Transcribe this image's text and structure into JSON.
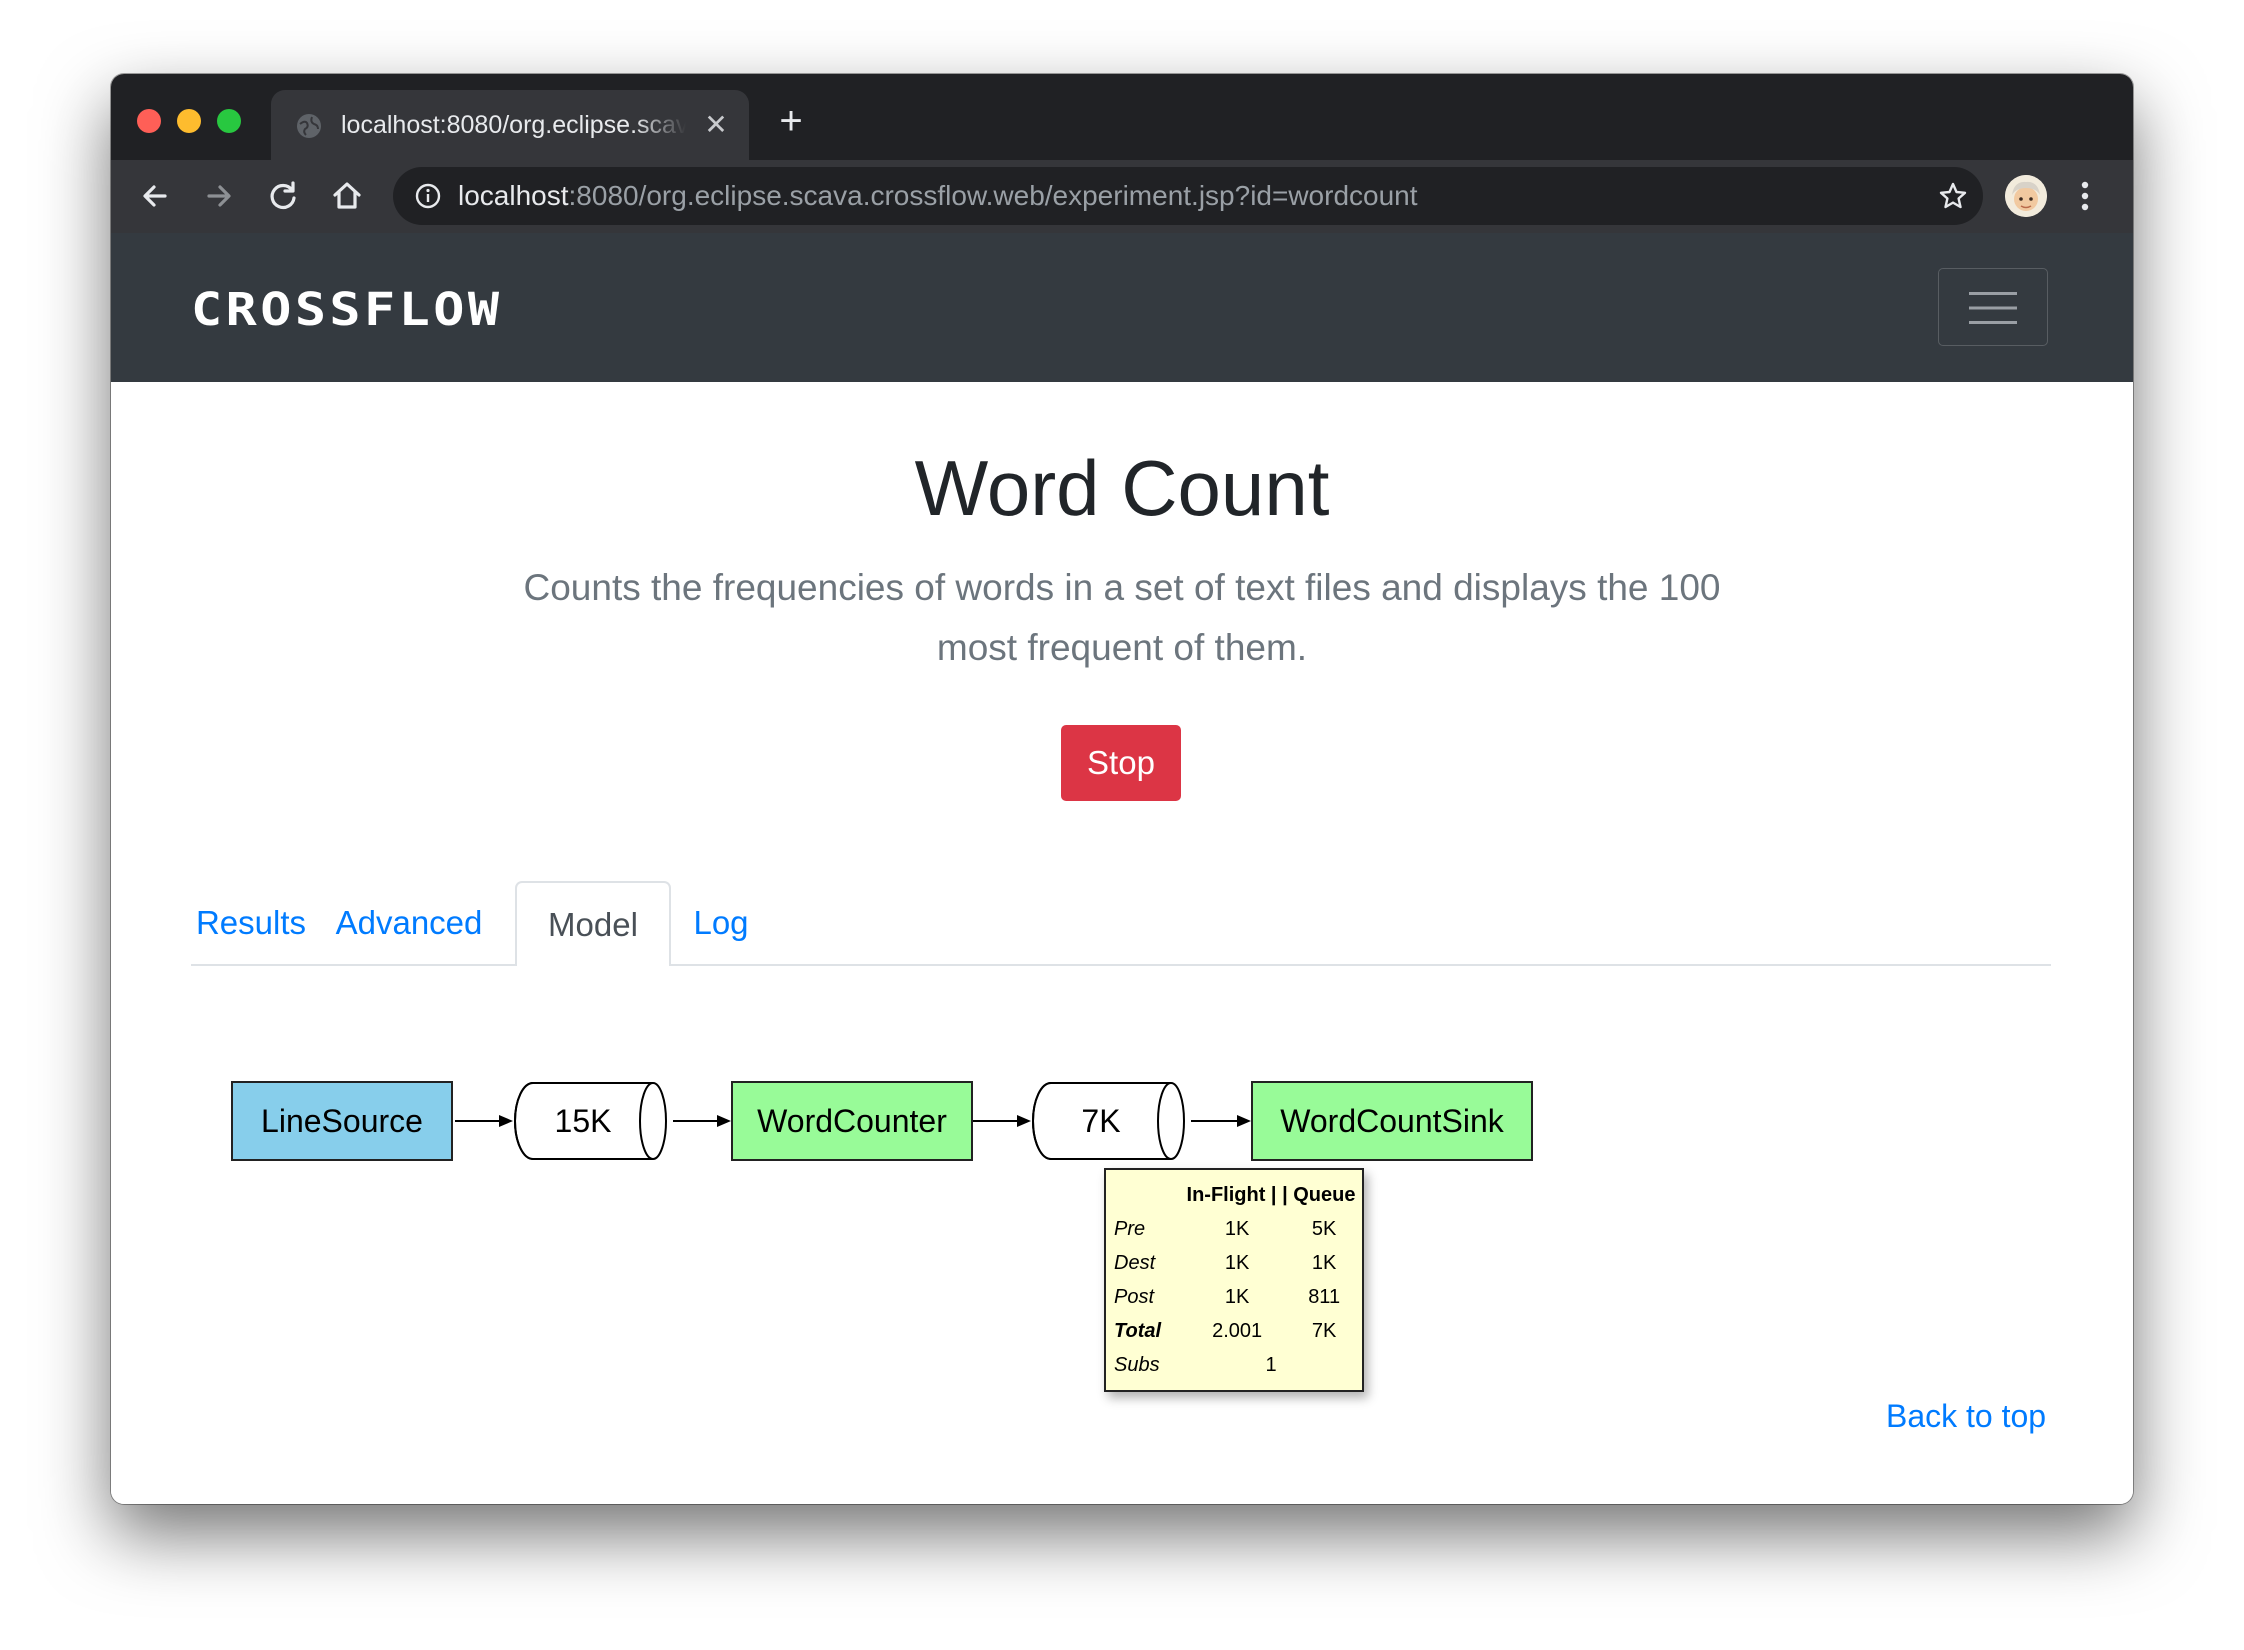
{
  "browser": {
    "tab_title": "localhost:8080/org.eclipse.scava.crossflow.web/experiment.jsp?id=wordcount",
    "url_host": "localhost",
    "url_rest": ":8080/org.eclipse.scava.crossflow.web/experiment.jsp?id=wordcount",
    "icons": [
      "back-arrow-icon",
      "forward-arrow-icon",
      "reload-icon",
      "home-icon",
      "info-icon",
      "star-icon",
      "profile-avatar",
      "menu-dots-icon"
    ]
  },
  "navbar": {
    "brand": "CROSSFLOW"
  },
  "page": {
    "title": "Word Count",
    "description": "Counts the frequencies of words in a set of text files and displays the 100 most frequent of them.",
    "stop_label": "Stop",
    "back_to_top": "Back to top"
  },
  "tabs": [
    {
      "label": "Results",
      "active": false
    },
    {
      "label": "Advanced",
      "active": false
    },
    {
      "label": "Model",
      "active": true
    },
    {
      "label": "Log",
      "active": false
    }
  ],
  "model": {
    "nodes": [
      {
        "label": "LineSource",
        "kind": "source",
        "color": "#87ceeb"
      },
      {
        "label": "15K",
        "kind": "queue"
      },
      {
        "label": "WordCounter",
        "kind": "task",
        "color": "#98fb98"
      },
      {
        "label": "7K",
        "kind": "queue"
      },
      {
        "label": "WordCountSink",
        "kind": "task",
        "color": "#98fb98"
      }
    ],
    "tooltip": {
      "header": "In-Flight | | Queue",
      "rows": [
        {
          "label": "Pre",
          "inflight": "1K",
          "queue": "5K"
        },
        {
          "label": "Dest",
          "inflight": "1K",
          "queue": "1K"
        },
        {
          "label": "Post",
          "inflight": "1K",
          "queue": "811"
        },
        {
          "label": "Total",
          "inflight": "2.001",
          "queue": "7K"
        },
        {
          "label": "Subs",
          "value": "1"
        }
      ]
    }
  },
  "colors": {
    "navbar_bg": "#343a40",
    "stop_button": "#dc3545",
    "link": "#007bff",
    "source_node": "#87ceeb",
    "task_node": "#98fb98",
    "tooltip_bg": "#ffffd3"
  }
}
